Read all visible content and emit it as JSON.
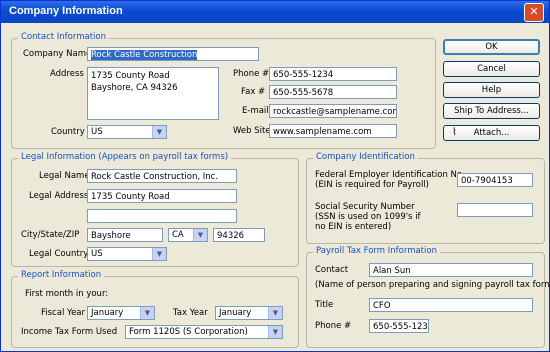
{
  "window": {
    "title": "Company Information",
    "close": "✕"
  },
  "buttons": {
    "ok": "OK",
    "cancel": "Cancel",
    "help": "Help",
    "ship_to": "Ship To Address...",
    "attach": "Attach..."
  },
  "contact": {
    "group_title": "Contact Information",
    "company_name_label": "Company Name",
    "company_name": "Rock Castle Construction",
    "address_label": "Address",
    "address_line1": "1735 County Road",
    "address_line2": "Bayshore, CA 94326",
    "country_label": "Country",
    "country": "US",
    "phone_label": "Phone #",
    "phone": "650-555-1234",
    "fax_label": "Fax #",
    "fax": "650-555-5678",
    "email_label": "E-mail",
    "email": "rockcastle@samplename.com",
    "website_label": "Web Site",
    "website": "www.samplename.com"
  },
  "legal": {
    "group_title": "Legal Information (Appears on payroll tax forms)",
    "legal_name_label": "Legal Name",
    "legal_name": "Rock Castle Construction, Inc.",
    "legal_address_label": "Legal Address",
    "legal_address": "1735 County Road",
    "legal_address2": "",
    "city_label": "City/State/ZIP",
    "city": "Bayshore",
    "state": "CA",
    "zip": "94326",
    "country_label": "Legal Country",
    "country": "US"
  },
  "company_id": {
    "group_title": "Company Identification",
    "fein_label1": "Federal Employer Identification No.",
    "fein_label2": "(EIN is required for Payroll)",
    "fein": "00-7904153",
    "ssn_label1": "Social Security Number",
    "ssn_label2": "(SSN is used on 1099's if",
    "ssn_label3": "no EIN is entered)",
    "ssn": ""
  },
  "report": {
    "group_title": "Report Information",
    "first_month_label": "First month in your:",
    "fiscal_year_label": "Fiscal Year",
    "fiscal_year": "January",
    "tax_year_label": "Tax Year",
    "tax_year": "January",
    "income_tax_form_label": "Income Tax Form Used",
    "income_tax_form": "Form 1120S (S Corporation)"
  },
  "payroll_tax": {
    "group_title": "Payroll Tax Form Information",
    "contact_label": "Contact",
    "contact": "Alan Sun",
    "contact_note": "(Name of person preparing and signing payroll tax forms)",
    "title_label": "Title",
    "title": "CFO",
    "phone_label": "Phone #",
    "phone": "650-555-1234"
  }
}
